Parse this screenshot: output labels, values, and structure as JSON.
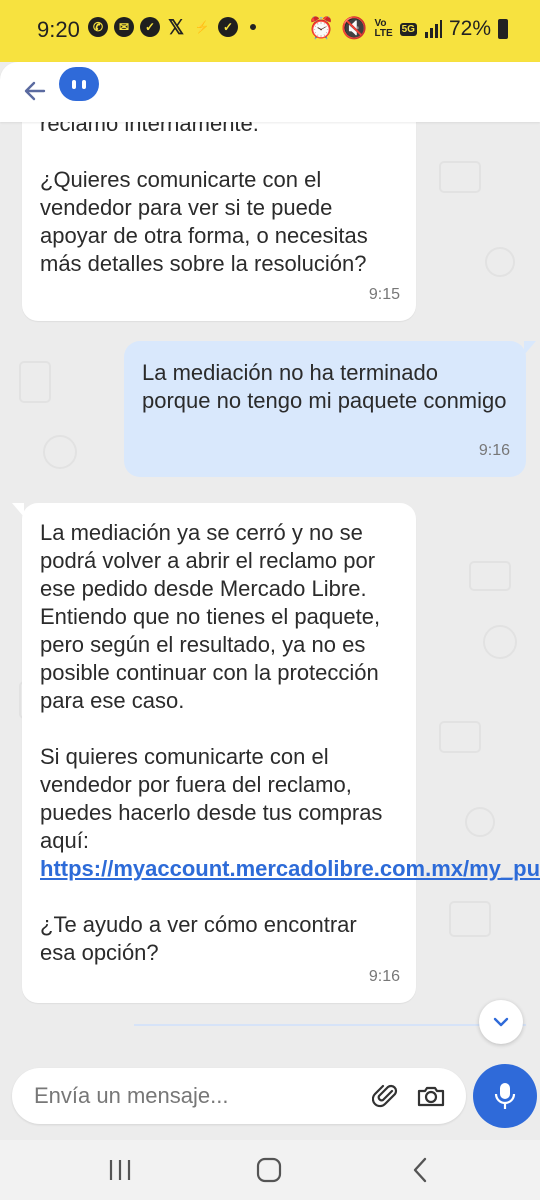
{
  "status_bar": {
    "time": "9:20",
    "battery": "72%",
    "network": "5G"
  },
  "messages": [
    {
      "from": "agent",
      "paragraphs": [
        "reclamo internamente.",
        "¿Quieres comunicarte con el vendedor para ver si te puede apoyar de otra forma, o necesitas más detalles sobre la resolución?"
      ],
      "time": "9:15"
    },
    {
      "from": "user",
      "text": "La mediación no ha terminado porque no tengo mi paquete conmigo",
      "time": "9:16"
    },
    {
      "from": "agent",
      "p1": "La mediación ya se cerró y no se podrá volver a abrir el reclamo por ese pedido desde Mercado Libre. Entiendo que no tienes el paquete, pero según el resultado, ya no es posible continuar con la protección para ese caso.",
      "p2": "Si quieres comunicarte con el vendedor por fuera del reclamo, puedes hacerlo desde tus compras aquí:",
      "link": "https://myaccount.mercadolibre.com.mx/my_pur…",
      "link_suffix": ".",
      "p3": "¿Te ayudo a ver cómo encontrar esa opción?",
      "time": "9:16"
    }
  ],
  "composer": {
    "placeholder": "Envía un mensaje..."
  },
  "colors": {
    "accent": "#2f6ad9",
    "status_bar": "#f7e23f",
    "user_bubble": "#d9e8fc"
  }
}
